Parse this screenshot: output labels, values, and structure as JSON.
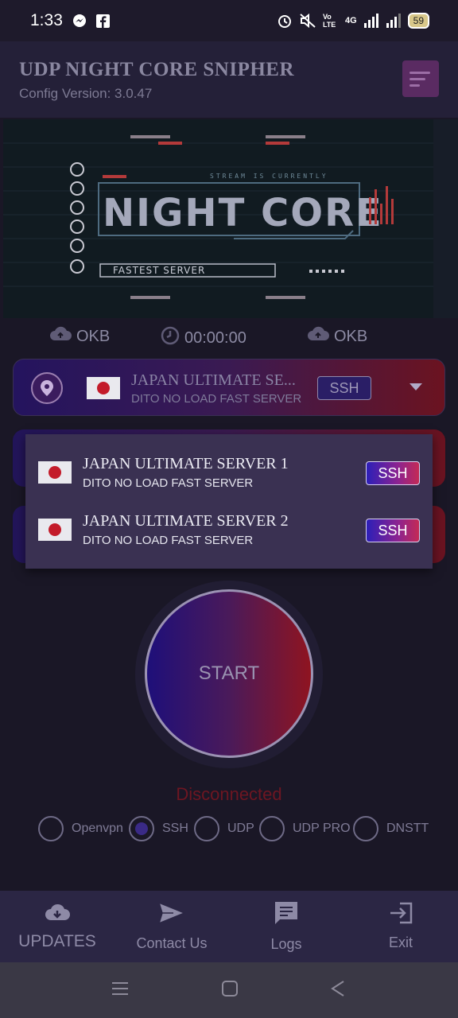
{
  "status_bar": {
    "time": "1:33",
    "network_label": "4G",
    "volte_label": "Vo LTE",
    "battery": "59"
  },
  "header": {
    "title": "UDP NIGHT CORE SNIPHER",
    "subtitle": "Config Version: 3.0.47"
  },
  "banner": {
    "headline": "NIGHT CORE",
    "tagline": "STREAM IS CURRENTLY",
    "caption": "FASTEST SERVER"
  },
  "stats": {
    "download": "OKB",
    "timer": "00:00:00",
    "upload": "OKB"
  },
  "selected_server": {
    "name": "JAPAN ULTIMATE SE...",
    "description": "DITO NO LOAD FAST SERVER",
    "tag": "SSH"
  },
  "server_dropdown": [
    {
      "name": "JAPAN ULTIMATE SERVER 1",
      "description": "DITO NO LOAD FAST SERVER",
      "tag": "SSH"
    },
    {
      "name": "JAPAN ULTIMATE SERVER 2",
      "description": "DITO NO LOAD FAST SERVER",
      "tag": "SSH"
    }
  ],
  "start_button": {
    "label": "START"
  },
  "connection_status": "Disconnected",
  "protocols": [
    {
      "label": "Openvpn",
      "selected": false
    },
    {
      "label": "SSH",
      "selected": true
    },
    {
      "label": "UDP",
      "selected": false
    },
    {
      "label": "UDP PRO",
      "selected": false
    },
    {
      "label": "DNSTT",
      "selected": false
    }
  ],
  "bottom_nav": [
    {
      "label": "UPDATES",
      "icon": "cloud-download-icon"
    },
    {
      "label": "Contact Us",
      "icon": "send-icon"
    },
    {
      "label": "Logs",
      "icon": "chat-icon"
    },
    {
      "label": "Exit",
      "icon": "exit-icon"
    }
  ],
  "colors": {
    "background": "#1a1726",
    "header": "#242038",
    "accent_blue": "#1e0f7a",
    "accent_red": "#8f1420",
    "disconnected": "#6d1622"
  }
}
